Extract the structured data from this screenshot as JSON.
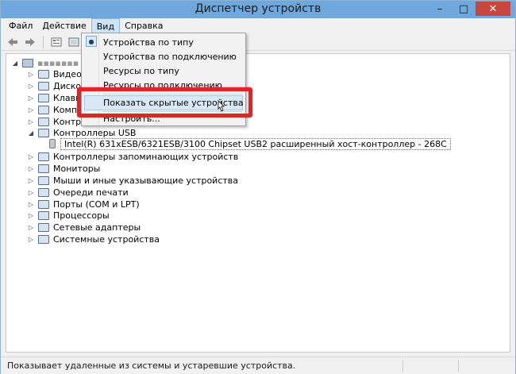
{
  "window": {
    "title": "Диспетчер устройств"
  },
  "title_buttons": {
    "minimize": "–",
    "maximize": "□",
    "close": "✕"
  },
  "menubar": {
    "items": [
      "Файл",
      "Действие",
      "Вид",
      "Справка"
    ]
  },
  "view_menu": {
    "items": [
      "Устройства по типу",
      "Устройства по подключению",
      "Ресурсы по типу",
      "Ресурсы по подключению",
      "Показать скрытые устройства",
      "Настроить..."
    ],
    "checked_index": 0,
    "highlighted_index": 4
  },
  "tree": {
    "root": "",
    "categories": [
      "Видеоадаптеры",
      "Дисковые устройства",
      "Клавиатуры",
      "Компьютер",
      "Контроллеры IDE ATA/ATAPI",
      "Контроллеры USB",
      "Контроллеры запоминающих устройств",
      "Мониторы",
      "Мыши и иные указывающие устройства",
      "Очереди печати",
      "Порты (COM и LPT)",
      "Процессоры",
      "Сетевые адаптеры",
      "Системные устройства"
    ],
    "visible_partial": [
      "Видео",
      "Дисков",
      "Клави",
      "Компь",
      "Контрол"
    ],
    "usb_child": "Intel(R) 631xESB/6321ESB/3100 Chipset USB2 расширенный хост-контроллер  - 268C"
  },
  "status": {
    "text": "Показывает удаленные из системы и устаревшие устройства."
  },
  "colors": {
    "titlebar": "#6fa8dc",
    "close_button": "#c7463f",
    "highlight_frame": "#e02525",
    "menu_active": "#cde4f7"
  }
}
